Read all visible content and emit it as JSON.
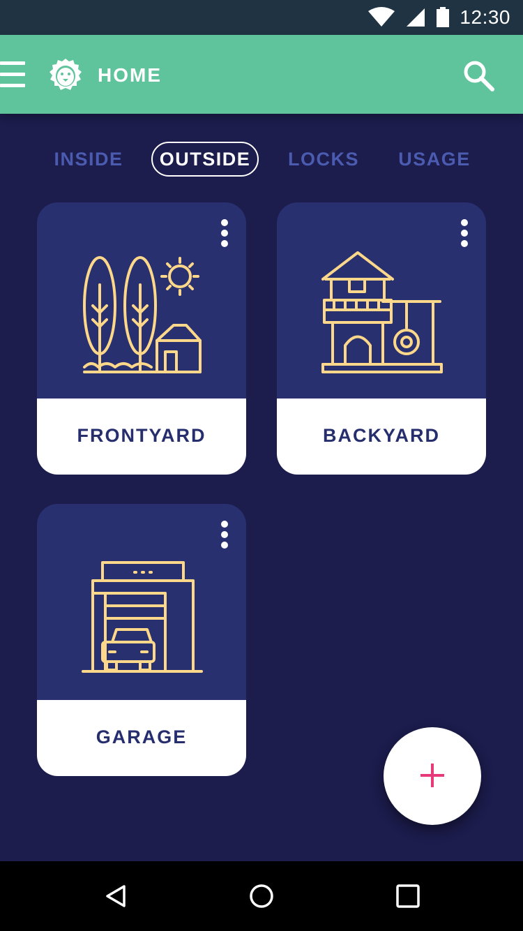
{
  "status_bar": {
    "time": "12:30",
    "icons": [
      "wifi-icon",
      "signal-icon",
      "battery-icon"
    ]
  },
  "app_bar": {
    "title": "HOME",
    "icons": [
      "menu-icon",
      "lion-logo-icon",
      "search-icon"
    ]
  },
  "tabs": [
    {
      "label": "INSIDE",
      "active": false
    },
    {
      "label": "OUTSIDE",
      "active": true
    },
    {
      "label": "LOCKS",
      "active": false
    },
    {
      "label": "USAGE",
      "active": false
    }
  ],
  "cards": [
    {
      "label": "FRONTYARD",
      "icon": "frontyard-icon"
    },
    {
      "label": "BACKYARD",
      "icon": "backyard-icon"
    },
    {
      "label": "GARAGE",
      "icon": "garage-icon"
    }
  ],
  "fab": {
    "icon": "plus-icon"
  },
  "nav_bar": {
    "icons": [
      "back-icon",
      "home-icon",
      "recents-icon"
    ]
  },
  "colors": {
    "status_bar": "#1f3342",
    "app_bar": "#5fc39c",
    "background": "#1c1c4d",
    "card": "#283070",
    "tab_inactive": "#4b5bb0",
    "illustration": "#fdd88a",
    "fab_plus": "#e8397a"
  }
}
